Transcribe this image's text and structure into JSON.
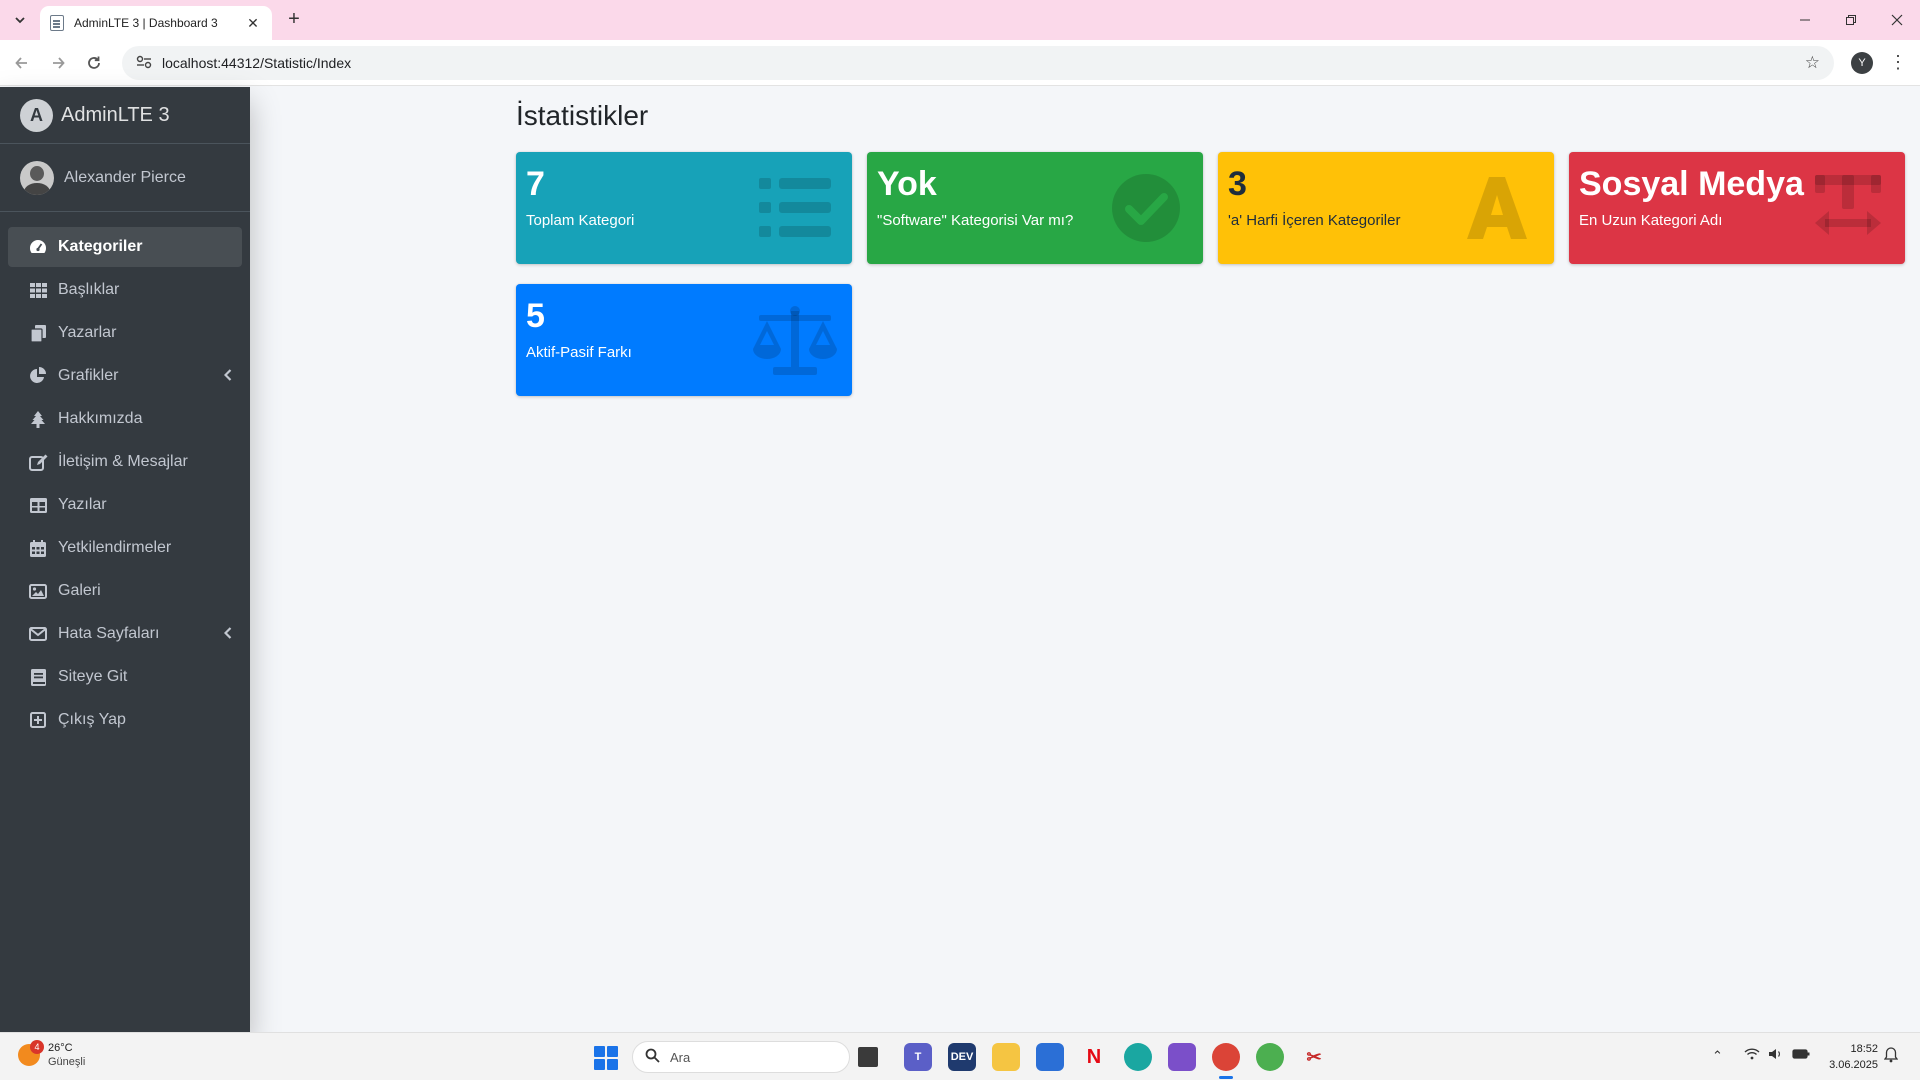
{
  "browser": {
    "tab_title": "AdminLTE 3 | Dashboard 3",
    "url": "localhost:44312/Statistic/Index",
    "profile_initial": "Y"
  },
  "sidebar": {
    "brand": "AdminLTE 3",
    "user": "Alexander Pierce",
    "items": [
      {
        "label": "Kategoriler",
        "icon": "dashboard-icon"
      },
      {
        "label": "Başlıklar",
        "icon": "th-icon"
      },
      {
        "label": "Yazarlar",
        "icon": "copy-icon"
      },
      {
        "label": "Grafikler",
        "icon": "chart-pie-icon"
      },
      {
        "label": "Hakkımızda",
        "icon": "tree-icon"
      },
      {
        "label": "İletişim & Mesajlar",
        "icon": "edit-icon"
      },
      {
        "label": "Yazılar",
        "icon": "table-icon"
      },
      {
        "label": "Yetkilendirmeler",
        "icon": "calendar-icon"
      },
      {
        "label": "Galeri",
        "icon": "image-icon"
      },
      {
        "label": "Hata Sayfaları",
        "icon": "envelope-icon"
      },
      {
        "label": "Siteye Git",
        "icon": "book-icon"
      },
      {
        "label": "Çıkış Yap",
        "icon": "plus-square-icon"
      }
    ]
  },
  "content": {
    "title": "İstatistikler",
    "boxes": [
      {
        "value": "7",
        "label": "Toplam Kategori",
        "icon": "list-icon",
        "color": "#17a2b8"
      },
      {
        "value": "Yok",
        "label": "\"Software\" Kategorisi Var mı?",
        "icon": "check-circle-icon",
        "color": "#28a745"
      },
      {
        "value": "3",
        "label": "'a' Harfi İçeren Kategoriler",
        "icon": "font-icon",
        "color": "#ffc107"
      },
      {
        "value": "Sosyal Medya",
        "label": "En Uzun Kategori Adı",
        "icon": "text-width-icon",
        "color": "#dc3545"
      },
      {
        "value": "5",
        "label": "Aktif-Pasif Farkı",
        "icon": "balance-scale-icon",
        "color": "#007bff"
      }
    ]
  },
  "taskbar": {
    "weather_temp": "26°C",
    "weather_desc": "Güneşli",
    "weather_badge": "4",
    "search_placeholder": "Ara",
    "time": "18:52",
    "date": "3.06.2025"
  }
}
